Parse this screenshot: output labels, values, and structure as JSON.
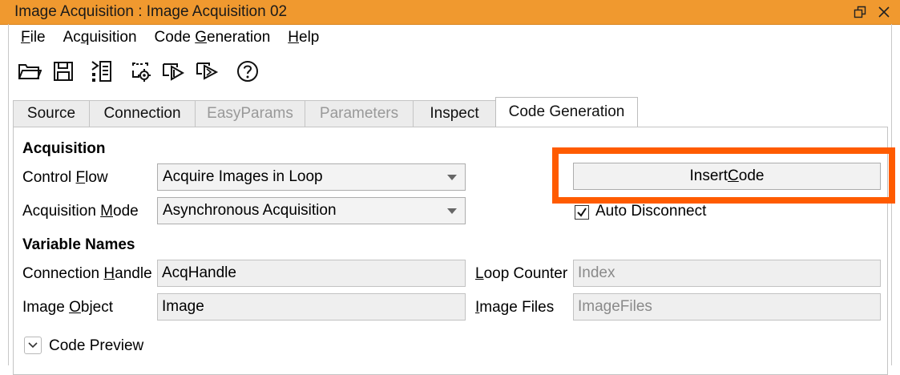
{
  "window": {
    "title": "Image Acquisition : Image Acquisition 02"
  },
  "menu": {
    "file": {
      "pre": "",
      "ul": "F",
      "post": "ile"
    },
    "acquisition": {
      "pre": "Ac",
      "ul": "q",
      "post": "uisition"
    },
    "code_generation": {
      "pre": "Code ",
      "ul": "G",
      "post": "eneration"
    },
    "help": {
      "pre": "",
      "ul": "H",
      "post": "elp"
    }
  },
  "toolbar_icons": [
    "folder-open-icon",
    "save-icon",
    "code-list-icon",
    "settings-icon",
    "acquire-single-icon",
    "acquire-live-icon",
    "help-icon"
  ],
  "tabs": [
    {
      "label": "Source",
      "state": "normal"
    },
    {
      "label": "Connection",
      "state": "normal"
    },
    {
      "label": "EasyParams",
      "state": "disabled"
    },
    {
      "label": "Parameters",
      "state": "disabled"
    },
    {
      "label": "Inspect",
      "state": "normal"
    },
    {
      "label": "Code Generation",
      "state": "active"
    }
  ],
  "acquisition": {
    "heading": "Acquisition",
    "control_flow": {
      "pre": "Control ",
      "ul": "F",
      "post": "low",
      "value": "Acquire Images in Loop"
    },
    "mode": {
      "pre": "Acquisition ",
      "ul": "M",
      "post": "ode",
      "value": "Asynchronous Acquisition"
    }
  },
  "actions": {
    "insert_code": {
      "pre": "Insert ",
      "ul": "C",
      "post": "ode"
    },
    "auto_disconnect": {
      "label": "Auto Disconnect",
      "checked": true
    }
  },
  "variables": {
    "heading": "Variable Names",
    "connection_handle": {
      "pre": "Connection ",
      "ul": "H",
      "post": "andle",
      "value": "AcqHandle"
    },
    "image_object": {
      "pre": "Image ",
      "ul": "O",
      "post": "bject",
      "value": "Image"
    },
    "loop_counter": {
      "pre": "",
      "ul": "L",
      "post": "oop Counter",
      "value": "Index"
    },
    "image_files": {
      "pre": "",
      "ul": "I",
      "post": "mage Files",
      "value": "ImageFiles"
    }
  },
  "preview": {
    "label": "Code Preview"
  },
  "colors": {
    "titlebar": "#f0992f",
    "highlight": "#ff5b00"
  }
}
